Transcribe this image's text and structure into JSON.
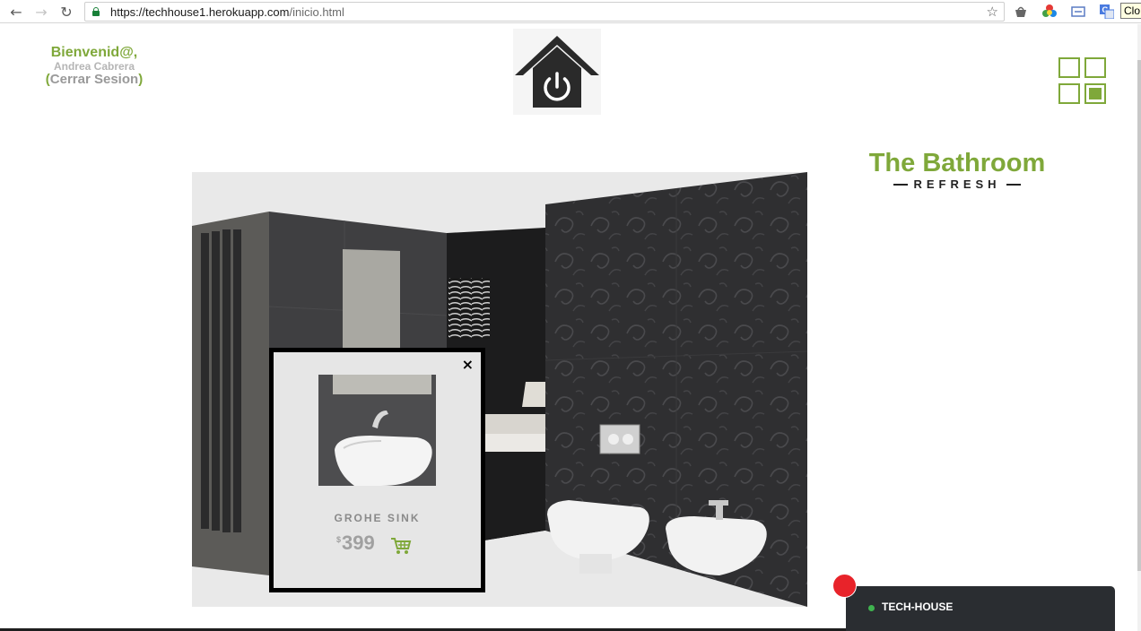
{
  "browser": {
    "url_host": "https://techhouse1.herokuapp.com",
    "url_path": "/inicio.html",
    "tooltip": "Clo"
  },
  "header": {
    "welcome": "Bienvenid@,",
    "user_name": "Andrea Cabrera",
    "logout_open": "(",
    "logout_label": "Cerrar Sesion",
    "logout_close": ")"
  },
  "room": {
    "title": "The Bathroom",
    "subtitle": "REFRESH"
  },
  "product": {
    "name": "GROHE SINK",
    "currency": "$",
    "price": "399",
    "close": "×"
  },
  "chat": {
    "label": "TECH-HOUSE"
  },
  "colors": {
    "accent_green": "#7fa83a",
    "chat_bar": "#2a2d31",
    "notification_red": "#e8232a",
    "status_green": "#3fb34f"
  },
  "icons": {
    "back": "arrow-left-icon",
    "forward": "arrow-right-icon",
    "reload": "reload-icon",
    "lock": "lock-icon",
    "bookmark": "star-icon",
    "logo": "house-power-icon",
    "view_switch": "grid-view-icon",
    "cart": "cart-icon",
    "close": "close-icon"
  }
}
